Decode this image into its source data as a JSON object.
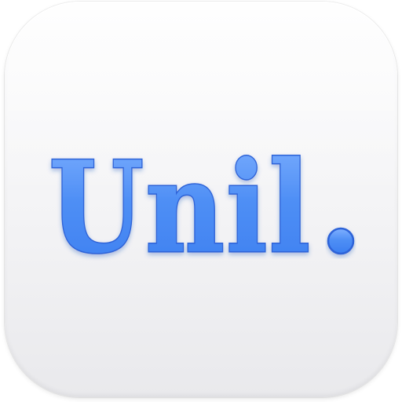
{
  "icon": {
    "wordmark": "Unil",
    "dot": ".",
    "text_color": "#4f8ff5",
    "text_highlight": "#9cc2ff",
    "text_outline": "#2f63d8",
    "background_top": "#fbfbfc",
    "background_bottom": "#e9e9ec"
  }
}
